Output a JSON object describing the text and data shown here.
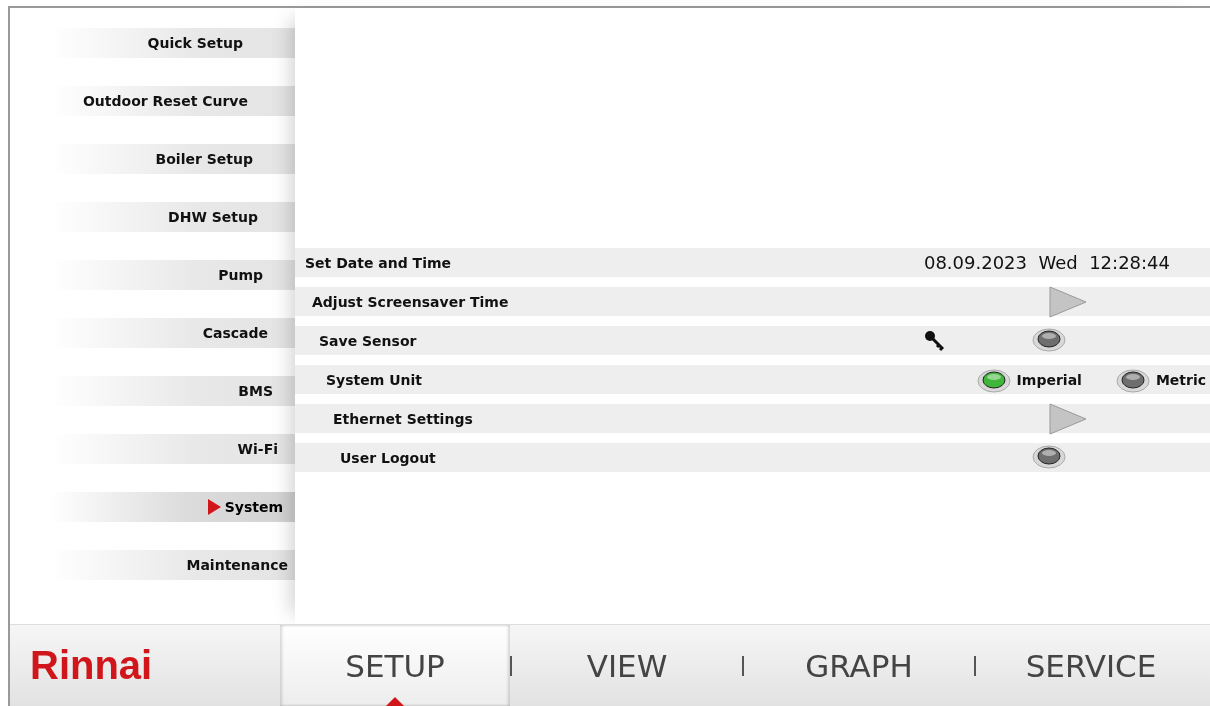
{
  "sidebar": {
    "items": [
      {
        "label": "Quick Setup",
        "selected": false
      },
      {
        "label": "Outdoor Reset Curve",
        "selected": false
      },
      {
        "label": "Boiler Setup",
        "selected": false
      },
      {
        "label": "DHW Setup",
        "selected": false
      },
      {
        "label": "Pump",
        "selected": false
      },
      {
        "label": "Cascade",
        "selected": false
      },
      {
        "label": "BMS",
        "selected": false
      },
      {
        "label": "Wi-Fi",
        "selected": false
      },
      {
        "label": "System",
        "selected": true
      },
      {
        "label": "Maintenance",
        "selected": false
      }
    ]
  },
  "settings": [
    {
      "kind": "datetime",
      "label": "Set Date and Time",
      "date": "08.09.2023",
      "weekday": "Wed",
      "time": "12:28:44"
    },
    {
      "kind": "arrow",
      "label": "Adjust Screensaver Time"
    },
    {
      "kind": "toggle",
      "label": "Save Sensor",
      "locked": true,
      "on": false
    },
    {
      "kind": "radio",
      "label": "System Unit",
      "options": [
        {
          "label": "Imperial",
          "selected": true
        },
        {
          "label": "Metric",
          "selected": false
        }
      ]
    },
    {
      "kind": "arrow",
      "label": "Ethernet Settings"
    },
    {
      "kind": "toggle",
      "label": "User Logout",
      "locked": false,
      "on": false
    }
  ],
  "nav": {
    "logo": "Rinnai",
    "tabs": [
      {
        "label": "SETUP",
        "selected": true
      },
      {
        "label": "VIEW",
        "selected": false
      },
      {
        "label": "GRAPH",
        "selected": false
      },
      {
        "label": "SERVICE",
        "selected": false
      }
    ]
  }
}
